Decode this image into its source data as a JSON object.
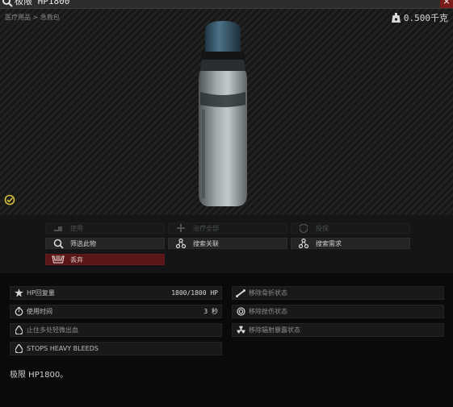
{
  "window": {
    "title": "极限 HP1800",
    "close_glyph": "×",
    "search_icon": "search-icon"
  },
  "preview": {
    "breadcrumb": "医疗用品 > 急救包",
    "weight": "0.500千克",
    "weight_icon": "weight-icon",
    "examined_icon": "examined-check-icon"
  },
  "actions": {
    "use": "使用",
    "heal_all": "治疗全部",
    "insure": "投保",
    "filter": "筛选此物",
    "linked_search": "搜索关联",
    "required_search": "搜索需求",
    "discard": "丢弃"
  },
  "properties": {
    "left": [
      {
        "label": "HP回复量",
        "value": "1800/1800 HP",
        "icon": "hp-cross-icon"
      },
      {
        "label": "使用时间",
        "value": "3 秒",
        "icon": "stopwatch-icon"
      },
      {
        "label": "止住多处轻微出血",
        "value": "",
        "icon": "blood-drop-icon"
      },
      {
        "label": "STOPS HEAVY BLEEDS",
        "value": "",
        "icon": "blood-drop-icon"
      }
    ],
    "right": [
      {
        "label": "移除骨折状态",
        "icon": "bone-icon"
      },
      {
        "label": "移除挫伤状态",
        "icon": "contusion-icon"
      },
      {
        "label": "移除辐射暴露状态",
        "icon": "radiation-icon"
      }
    ]
  },
  "description": "极限 HP1800。",
  "colors": {
    "accent_yellow": "#d4c23a",
    "danger": "#5a1616",
    "panel": "#17191a"
  }
}
